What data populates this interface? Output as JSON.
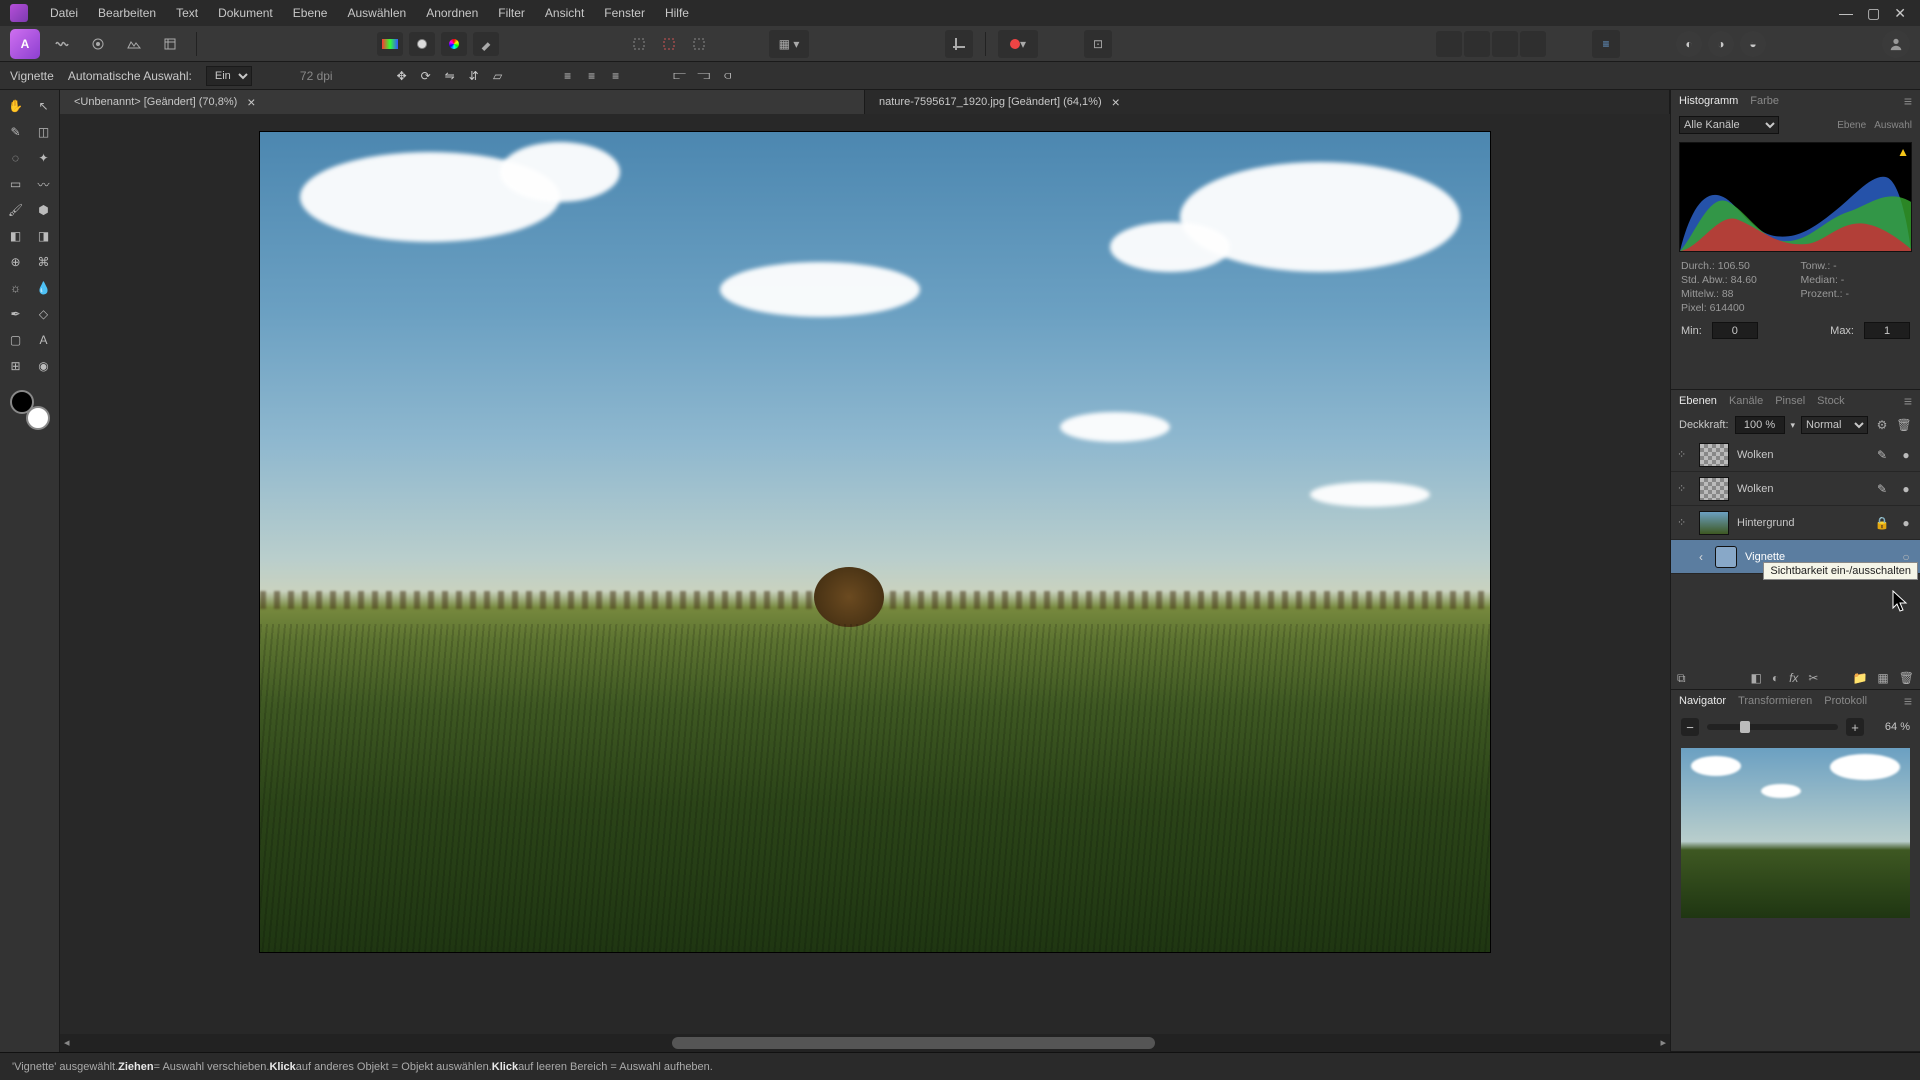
{
  "menus": [
    "Datei",
    "Bearbeiten",
    "Text",
    "Dokument",
    "Ebene",
    "Auswählen",
    "Anordnen",
    "Filter",
    "Ansicht",
    "Fenster",
    "Hilfe"
  ],
  "context": {
    "tool_label": "Vignette",
    "auto_label": "Automatische Auswahl:",
    "auto_value": "Ein",
    "dpi": "72 dpi"
  },
  "tabs": [
    {
      "title": "<Unbenannt> [Geändert] (70,8%)",
      "active": true
    },
    {
      "title": "nature-7595617_1920.jpg [Geändert] (64,1%)",
      "active": false
    }
  ],
  "panels": {
    "histogram_tabs": [
      "Histogramm",
      "Farbe"
    ],
    "histogram_right": [
      "Ebene",
      "Auswahl"
    ],
    "channel_label": "Alle Kanäle",
    "stats": {
      "durch": "Durch.: 106.50",
      "tonw": "Tonw.: -",
      "std": "Std. Abw.: 84.60",
      "median": "Median: -",
      "mittel": "Mittelw.: 88",
      "prozent": "Prozent.: -",
      "pixel": "Pixel: 614400"
    },
    "min_label": "Min:",
    "min_value": "0",
    "max_label": "Max:",
    "max_value": "1",
    "right_tabs": [
      "Ebenen",
      "Kanäle",
      "Pinsel",
      "Stock"
    ],
    "opacity_label": "Deckkraft:",
    "opacity_value": "100 %",
    "blendmode": "Normal",
    "layers": [
      {
        "name": "Wolken",
        "fx": true,
        "thumb": "checker",
        "edit": true,
        "vis": true
      },
      {
        "name": "Wolken",
        "fx": true,
        "thumb": "checker",
        "edit": true,
        "vis": true
      },
      {
        "name": "Hintergrund",
        "fx": true,
        "thumb": "sky",
        "lock": true,
        "vis": true
      },
      {
        "name": "Vignette",
        "selected": true,
        "live": true,
        "vis": false
      }
    ],
    "tooltip": "Sichtbarkeit ein-/ausschalten",
    "nav_tabs": [
      "Navigator",
      "Transformieren",
      "Protokoll"
    ],
    "zoom": "64 %"
  },
  "status": {
    "pre": "'Vignette' ausgewählt. ",
    "b1": "Ziehen",
    "t1": " = Auswahl verschieben. ",
    "b2": "Klick",
    "t2": " auf anderes Objekt = Objekt auswählen. ",
    "b3": "Klick",
    "t3": " auf leeren Bereich = Auswahl aufheben."
  }
}
